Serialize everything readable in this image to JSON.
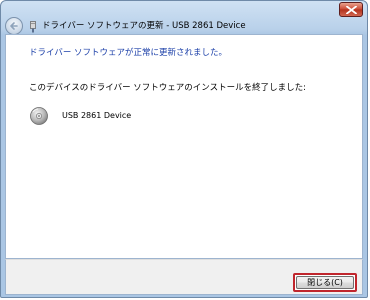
{
  "window": {
    "title": "ドライバー ソフトウェアの更新 - USB 2861 Device"
  },
  "content": {
    "headline": "ドライバー ソフトウェアが正常に更新されました。",
    "message": "このデバイスのドライバー ソフトウェアのインストールを終了しました:",
    "device_name": "USB 2861 Device"
  },
  "footer": {
    "close_button_label": "閉じる(C)"
  },
  "icons": {
    "window_close": "close-icon",
    "back": "back-arrow-icon",
    "title": "usb-device-icon",
    "device": "disc-drive-icon"
  },
  "colors": {
    "headline": "#1b3fa8",
    "close_button_border": "#c0262d",
    "titlebar": "#b9d1ea"
  }
}
